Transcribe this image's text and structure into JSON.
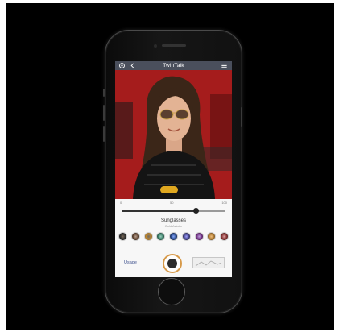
{
  "app": {
    "title": "TwinTalk",
    "settings_icon": "gear-icon",
    "back_icon": "chevron-left-icon",
    "menu_icon": "menu-icon",
    "header_color": "#4a4f5c"
  },
  "filter": {
    "name": "Sunglasses",
    "subtitle": "Gold Aviator",
    "pill_color": "#e0a820"
  },
  "slider": {
    "min_label": "0",
    "mid_label": "50",
    "max_label": "100",
    "value": 0.72
  },
  "swatches": [
    {
      "color": "#2a2a2a",
      "ring": "#7a6a5a"
    },
    {
      "color": "#5a3e2a",
      "ring": "#b8a090"
    },
    {
      "color": "#c78a2a",
      "ring": "#6a6a6a"
    },
    {
      "color": "#2e6f5a",
      "ring": "#9ad2c0"
    },
    {
      "color": "#1f3d7a",
      "ring": "#88aaff"
    },
    {
      "color": "#3a3a7a",
      "ring": "#a0a0ff"
    },
    {
      "color": "#6a2a7a",
      "ring": "#c0a0e0"
    },
    {
      "color": "#a6722a",
      "ring": "#f0c080"
    },
    {
      "color": "#7a2a2a",
      "ring": "#e0a0a0"
    }
  ],
  "bottom": {
    "left_label": "Usage",
    "capture_icon": "camera-capture-icon",
    "gallery_icon": "gallery-thumbnail-icon",
    "accent": "#d79a4a"
  }
}
